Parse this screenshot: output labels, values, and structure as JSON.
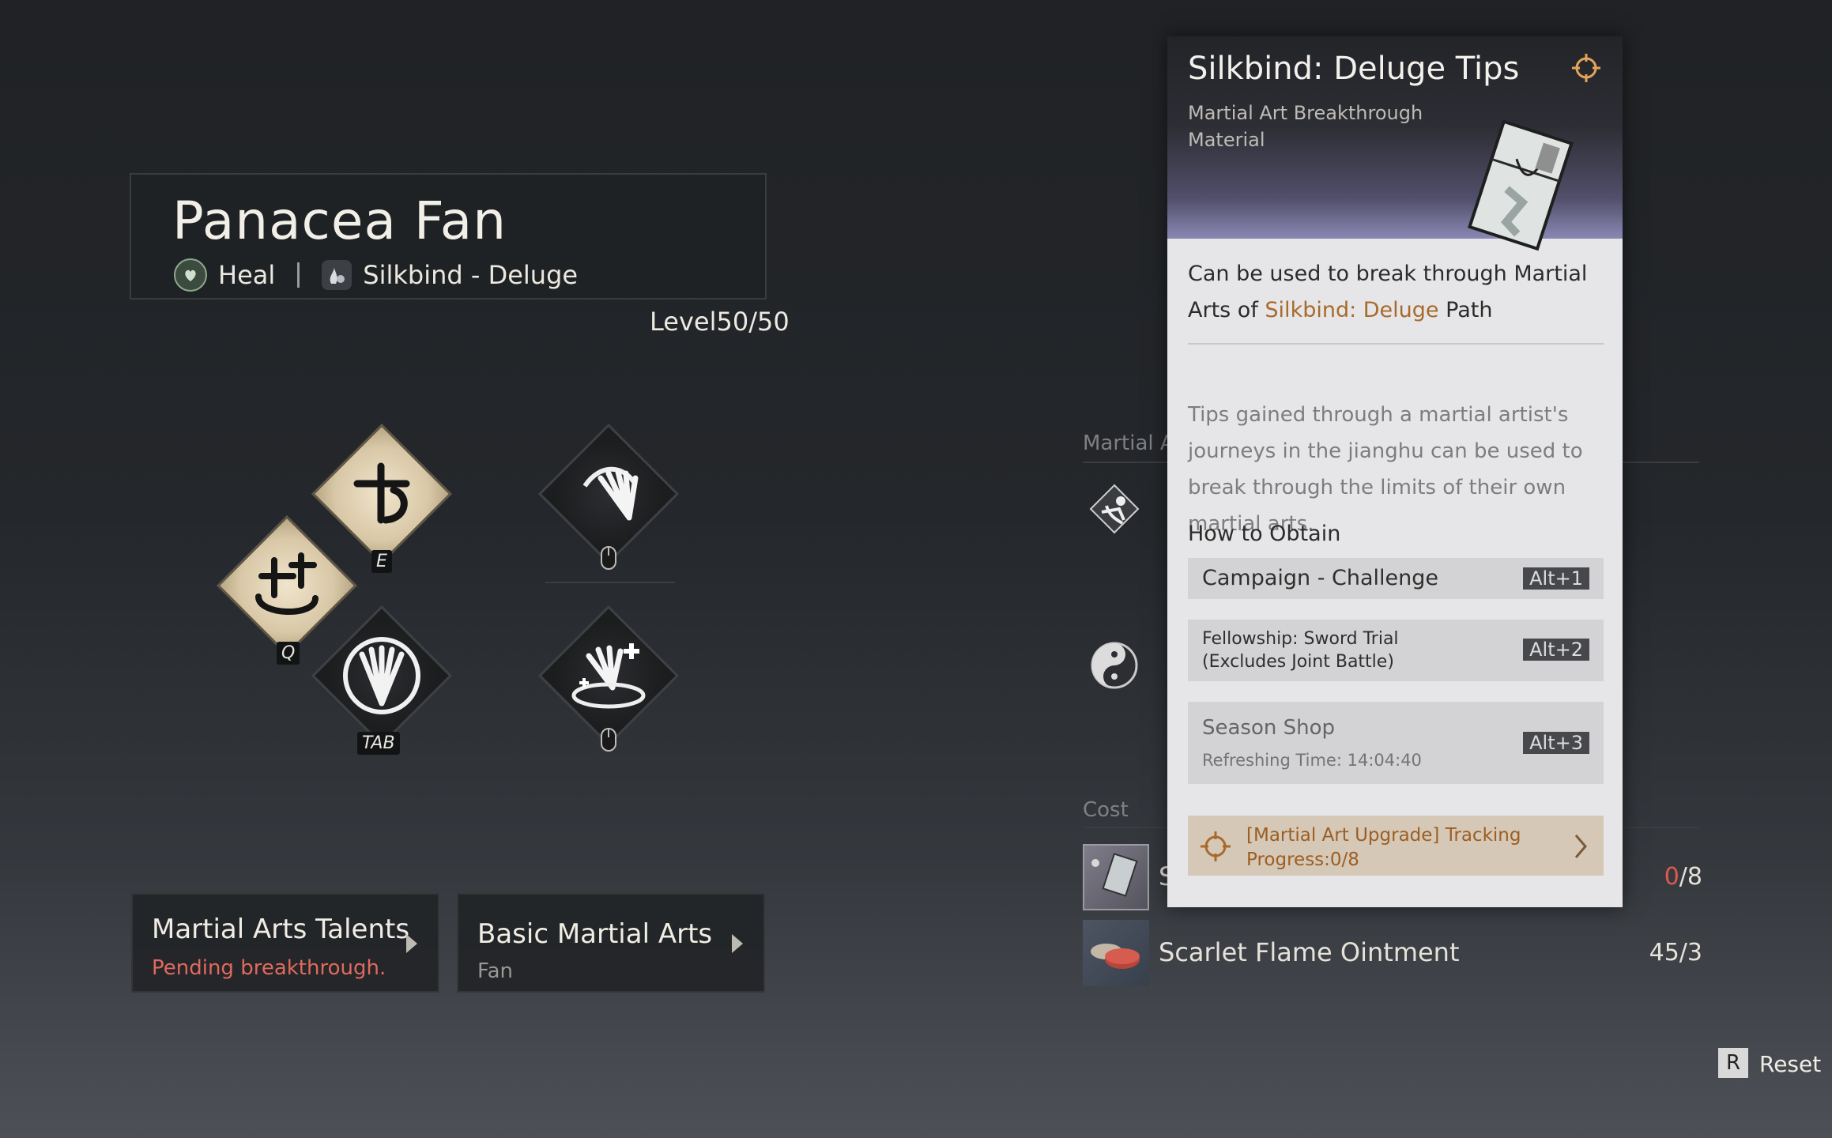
{
  "weapon": {
    "title": "Panacea Fan",
    "role": "Heal",
    "path": "Silkbind - Deluge",
    "level": "Level50/50"
  },
  "skills": {
    "key_e": "E",
    "key_q": "Q",
    "key_tab": "TAB"
  },
  "nav": {
    "talents_title": "Martial Arts Talents",
    "talents_sub": "Pending breakthrough.",
    "basic_title": "Basic Martial Arts",
    "basic_sub": "Fan"
  },
  "background_panel": {
    "section_label": "Martial Ar",
    "cost_label": "Cost",
    "cost_items": [
      {
        "name": "S",
        "have": "0",
        "need": "/8"
      },
      {
        "name": "Scarlet Flame Ointment",
        "qty": "45/3"
      }
    ]
  },
  "tooltip": {
    "title": "Silkbind: Deluge Tips",
    "subtitle": "Martial Art Breakthrough Material",
    "desc_pre": "Can be used to break through Martial Arts of ",
    "desc_highlight": "Silkbind: Deluge",
    "desc_post": " Path",
    "lore": "Tips gained through a martial artist's journeys in the jianghu can be used to break through the limits of their own martial arts.",
    "obtain_heading": "How to Obtain",
    "obtain": [
      {
        "label": "Campaign - Challenge",
        "key": "Alt+1"
      },
      {
        "label": "Fellowship: Sword Trial (Excludes Joint Battle)",
        "key": "Alt+2"
      },
      {
        "label": "Season Shop",
        "sub": "Refreshing Time: 14:04:40",
        "key": "Alt+3"
      }
    ],
    "tracking": "[Martial Art Upgrade] Tracking Progress:0/8"
  },
  "reset": {
    "key": "R",
    "label": "Reset"
  },
  "colors": {
    "accent_orange": "#a86a2c",
    "warning_red": "#e0584e",
    "tooltip_bg": "#e6e6e8"
  },
  "icons": [
    "heal-icon",
    "silkbind-icon",
    "target-icon",
    "fan-item-icon",
    "mouse-icon",
    "chevron-right-icon"
  ]
}
